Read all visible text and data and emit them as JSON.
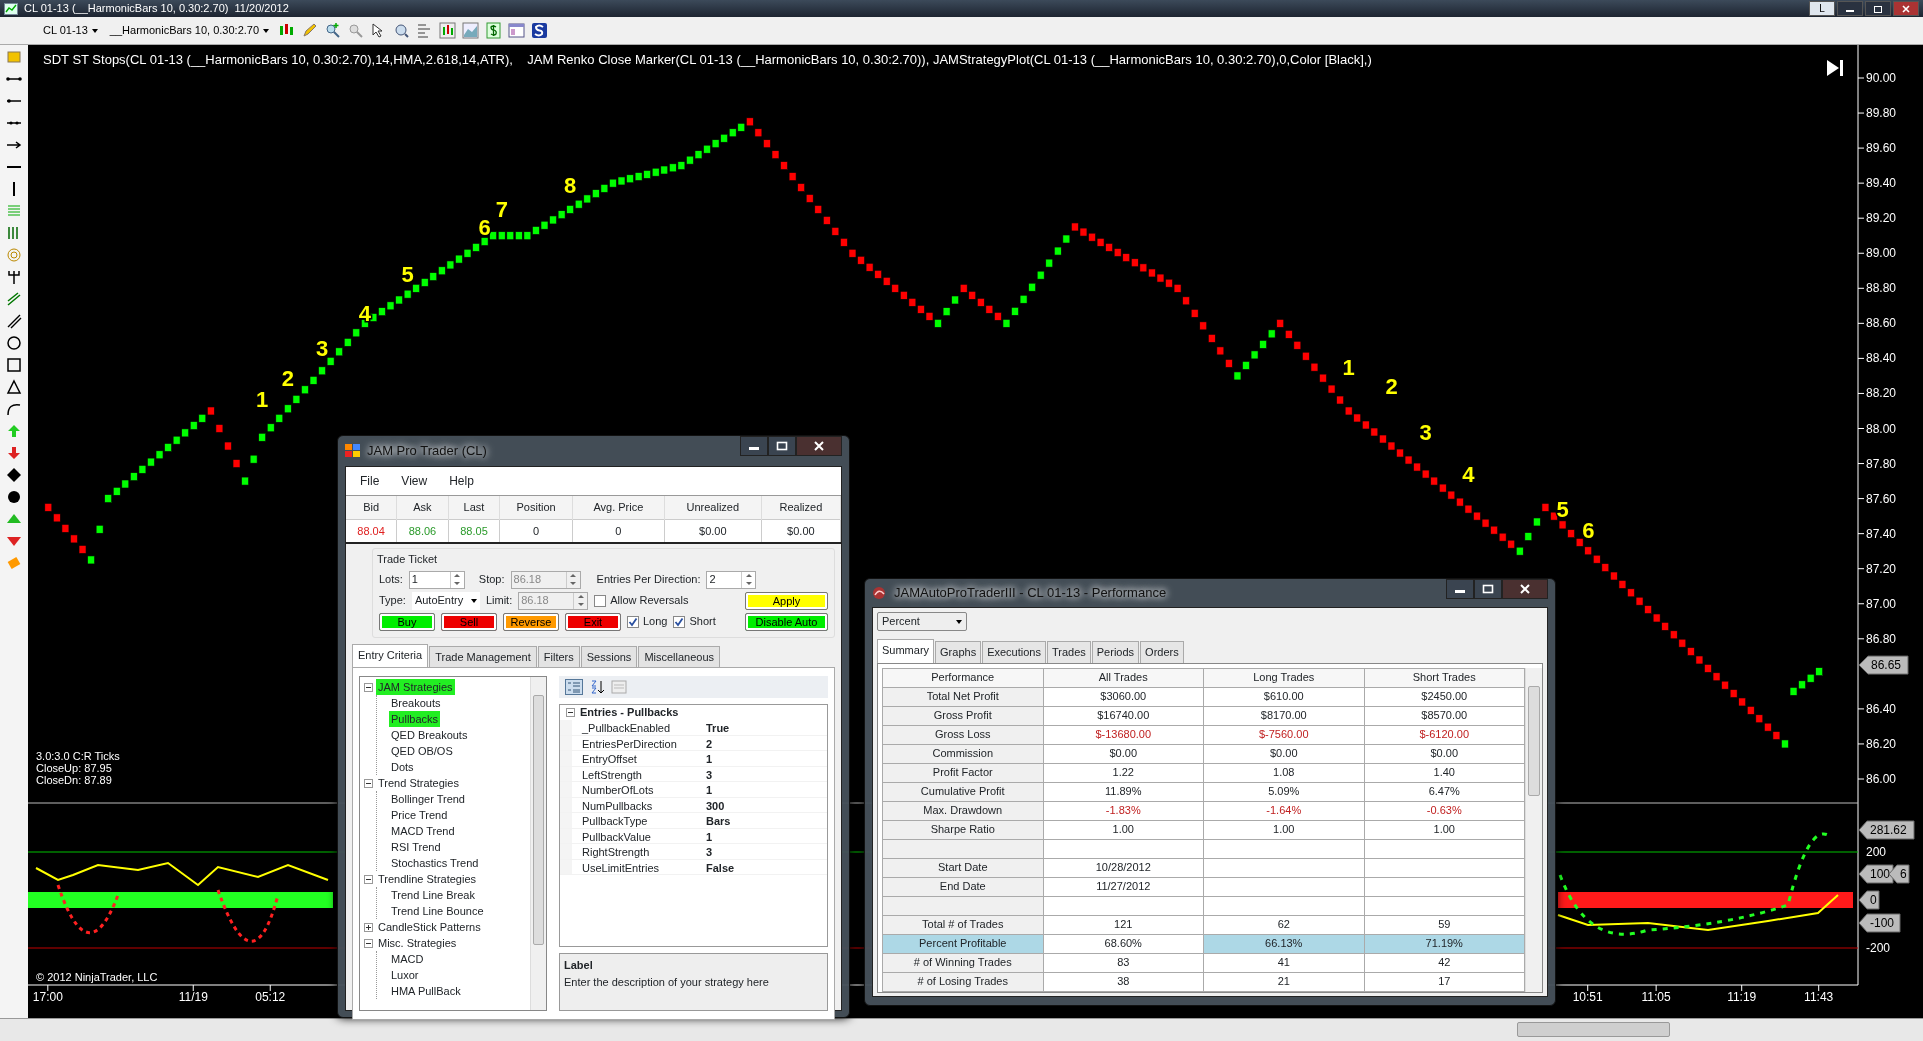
{
  "window": {
    "title": "CL 01-13 (__HarmonicBars 10, 0.30:2.70)  11/20/2012",
    "layout_button": "L"
  },
  "toolbar": {
    "instrument": "CL 01-13",
    "bar_type": "__HarmonicBars 10, 0.30:2.70"
  },
  "chart": {
    "indicator_legend": "SDT ST Stops(CL 01-13 (__HarmonicBars 10, 0.30:2.70),14,HMA,2.618,14,ATR),    JAM Renko Close Marker(CL 01-13 (__HarmonicBars 10, 0.30:2.70)), JAMStrategyPlot(CL 01-13 (__HarmonicBars 10, 0.30:2.70),0,Color [Black],)",
    "info_lines": [
      "3.0:3.0 C:R Ticks",
      "CloseUp: 87.95",
      "CloseDn: 87.89"
    ],
    "copyright": "© 2012 NinjaTrader, LLC",
    "last_price": "86.65",
    "price_axis": [
      "90.00",
      "89.80",
      "89.60",
      "89.40",
      "89.20",
      "89.00",
      "88.80",
      "88.60",
      "88.40",
      "88.20",
      "88.00",
      "87.80",
      "87.60",
      "87.40",
      "87.20",
      "87.00",
      "86.80",
      "86.40",
      "86.20",
      "86.00"
    ],
    "time_axis": [
      "17:00",
      "11/19",
      "05:12",
      "10:51",
      "11:05",
      "11:19",
      "11:43"
    ],
    "wave_labels": [
      "1",
      "2",
      "3",
      "4",
      "5",
      "6",
      "7",
      "8",
      "1",
      "2",
      "3",
      "4",
      "5",
      "6"
    ],
    "oscillator": {
      "labels": [
        {
          "text": "281.62",
          "kind": "badge"
        },
        {
          "text": "200",
          "kind": "plain"
        },
        {
          "text": "100",
          "kind": "badge"
        },
        {
          "text": "6",
          "kind": "badge"
        },
        {
          "text": "0",
          "kind": "badge"
        },
        {
          "text": "-100",
          "kind": "badge"
        },
        {
          "text": "-200",
          "kind": "plain"
        }
      ]
    }
  },
  "jam_pro_trader": {
    "title": "JAM Pro Trader (CL)",
    "menu": [
      "File",
      "View",
      "Help"
    ],
    "quote_columns": [
      "Bid",
      "Ask",
      "Last",
      "Position",
      "Avg. Price",
      "Unrealized",
      "Realized"
    ],
    "quote_values": [
      {
        "text": "88.04",
        "color": "#e02020"
      },
      {
        "text": "88.06",
        "color": "#2a9a2a"
      },
      {
        "text": "88.05",
        "color": "#2a9a2a"
      },
      {
        "text": "0"
      },
      {
        "text": "0"
      },
      {
        "text": "$0.00"
      },
      {
        "text": "$0.00"
      }
    ],
    "trade_ticket": {
      "legend": "Trade Ticket",
      "lots": {
        "label": "Lots:",
        "value": "1",
        "disabled": false
      },
      "stop": {
        "label": "Stop:",
        "value": "86.18",
        "disabled": true
      },
      "entries": {
        "label": "Entries Per Direction:",
        "value": "2",
        "disabled": false
      },
      "type": {
        "label": "Type:",
        "value": "AutoEntry"
      },
      "limit": {
        "label": "Limit:",
        "value": "86.18",
        "disabled": true
      },
      "checkboxes": [
        {
          "label": "Allow Reversals",
          "checked": false
        },
        {
          "label": "Long",
          "checked": true
        },
        {
          "label": "Short",
          "checked": true
        }
      ],
      "order_buttons": [
        {
          "label": "Buy",
          "color": "#00ee00"
        },
        {
          "label": "Sell",
          "color": "#ee0000"
        },
        {
          "label": "Reverse",
          "color": "#ff9900"
        },
        {
          "label": "Exit",
          "color": "#ee0000"
        }
      ],
      "apply_button": {
        "label": "Apply",
        "color": "#ffff00"
      },
      "auto_button": {
        "label": "Disable Auto",
        "color": "#00ee00"
      }
    },
    "tabs": [
      {
        "label": "Entry Criteria",
        "selected": true
      },
      {
        "label": "Trade Management",
        "selected": false
      },
      {
        "label": "Filters",
        "selected": false
      },
      {
        "label": "Sessions",
        "selected": false
      },
      {
        "label": "Miscellaneous",
        "selected": false
      }
    ],
    "tree": [
      {
        "label": "JAM Strategies",
        "selected": true,
        "expanded": true,
        "children": [
          {
            "label": "Breakouts",
            "selected": false
          },
          {
            "label": "Pullbacks",
            "selected": true
          },
          {
            "label": "QED Breakouts",
            "selected": false
          },
          {
            "label": "QED OB/OS",
            "selected": false
          },
          {
            "label": "Dots",
            "selected": false
          }
        ]
      },
      {
        "label": "Trend Strategies",
        "selected": false,
        "expanded": true,
        "children": [
          {
            "label": "Bollinger Trend",
            "selected": false
          },
          {
            "label": "Price Trend",
            "selected": false
          },
          {
            "label": "MACD Trend",
            "selected": false
          },
          {
            "label": "RSI Trend",
            "selected": false
          },
          {
            "label": "Stochastics Trend",
            "selected": false
          }
        ]
      },
      {
        "label": "Trendline Strategies",
        "selected": false,
        "expanded": true,
        "children": [
          {
            "label": "Trend Line Break",
            "selected": false
          },
          {
            "label": "Trend Line Bounce",
            "selected": false
          }
        ]
      },
      {
        "label": "CandleStick Patterns",
        "selected": false,
        "expanded": false
      },
      {
        "label": "Misc. Strategies",
        "selected": false,
        "expanded": true,
        "children": [
          {
            "label": "MACD",
            "selected": false
          },
          {
            "label": "Luxor",
            "selected": false
          },
          {
            "label": "HMA PullBack",
            "selected": false
          }
        ]
      }
    ],
    "property_grid": {
      "category": "Entries - Pullbacks",
      "expanded": true,
      "properties": [
        {
          "name": "_PullbackEnabled",
          "value": "True"
        },
        {
          "name": "EntriesPerDirection",
          "value": "2"
        },
        {
          "name": "EntryOffset",
          "value": "1"
        },
        {
          "name": "LeftStrength",
          "value": "3"
        },
        {
          "name": "NumberOfLots",
          "value": "1"
        },
        {
          "name": "NumPullbacks",
          "value": "300"
        },
        {
          "name": "PullbackType",
          "value": "Bars"
        },
        {
          "name": "PullbackValue",
          "value": "1"
        },
        {
          "name": "RightStrength",
          "value": "3"
        },
        {
          "name": "UseLimitEntries",
          "value": "False"
        }
      ],
      "description_title": "Label",
      "description": "Enter the description of your strategy here"
    }
  },
  "performance": {
    "title": "JAMAutoProTraderIII - CL 01-13 - Performance",
    "display": "Percent",
    "tabs": [
      {
        "label": "Summary",
        "selected": true
      },
      {
        "label": "Graphs",
        "selected": false
      },
      {
        "label": "Executions",
        "selected": false
      },
      {
        "label": "Trades",
        "selected": false
      },
      {
        "label": "Periods",
        "selected": false
      },
      {
        "label": "Orders",
        "selected": false
      }
    ],
    "columns": [
      "Performance",
      "All Trades",
      "Long Trades",
      "Short Trades"
    ],
    "rows": [
      {
        "cells": [
          "Total Net Profit",
          "$3060.00",
          "$610.00",
          "$2450.00"
        ],
        "negative": false,
        "highlight": [
          false,
          false,
          false,
          false
        ]
      },
      {
        "cells": [
          "Gross Profit",
          "$16740.00",
          "$8170.00",
          "$8570.00"
        ],
        "negative": false,
        "highlight": [
          false,
          false,
          false,
          false
        ]
      },
      {
        "cells": [
          "Gross Loss",
          "$-13680.00",
          "$-7560.00",
          "$-6120.00"
        ],
        "negative": true,
        "highlight": [
          false,
          false,
          false,
          false
        ]
      },
      {
        "cells": [
          "Commission",
          "$0.00",
          "$0.00",
          "$0.00"
        ],
        "negative": false,
        "highlight": [
          false,
          false,
          false,
          false
        ]
      },
      {
        "cells": [
          "Profit Factor",
          "1.22",
          "1.08",
          "1.40"
        ],
        "negative": false,
        "highlight": [
          false,
          false,
          false,
          false
        ]
      },
      {
        "cells": [
          "Cumulative Profit",
          "11.89%",
          "5.09%",
          "6.47%"
        ],
        "negative": false,
        "highlight": [
          false,
          false,
          false,
          false
        ]
      },
      {
        "cells": [
          "Max. Drawdown",
          "-1.83%",
          "-1.64%",
          "-0.63%"
        ],
        "negative": true,
        "highlight": [
          false,
          false,
          false,
          false
        ]
      },
      {
        "cells": [
          "Sharpe Ratio",
          "1.00",
          "1.00",
          "1.00"
        ],
        "negative": false,
        "highlight": [
          false,
          false,
          false,
          false
        ]
      },
      {
        "cells": [],
        "highlight": [
          false,
          false,
          false,
          false
        ]
      },
      {
        "cells": [
          "Start Date",
          "10/28/2012"
        ],
        "negative": false,
        "highlight": [
          false,
          false,
          false,
          false
        ]
      },
      {
        "cells": [
          "End Date",
          "11/27/2012"
        ],
        "negative": false,
        "highlight": [
          false,
          false,
          false,
          false
        ]
      },
      {
        "cells": [],
        "highlight": [
          false,
          false,
          false,
          false
        ]
      },
      {
        "cells": [
          "Total # of Trades",
          "121",
          "62",
          "59"
        ],
        "negative": false,
        "highlight": [
          false,
          false,
          false,
          false
        ]
      },
      {
        "cells": [
          "Percent Profitable",
          "68.60%",
          "66.13%",
          "71.19%"
        ],
        "negative": false,
        "highlight": [
          true,
          false,
          true,
          true
        ]
      },
      {
        "cells": [
          "# of Winning Trades",
          "83",
          "41",
          "42"
        ],
        "negative": false,
        "highlight": [
          false,
          false,
          false,
          false
        ]
      },
      {
        "cells": [
          "# of Losing Trades",
          "38",
          "21",
          "17"
        ],
        "negative": false,
        "highlight": [
          false,
          false,
          false,
          false
        ]
      }
    ]
  }
}
